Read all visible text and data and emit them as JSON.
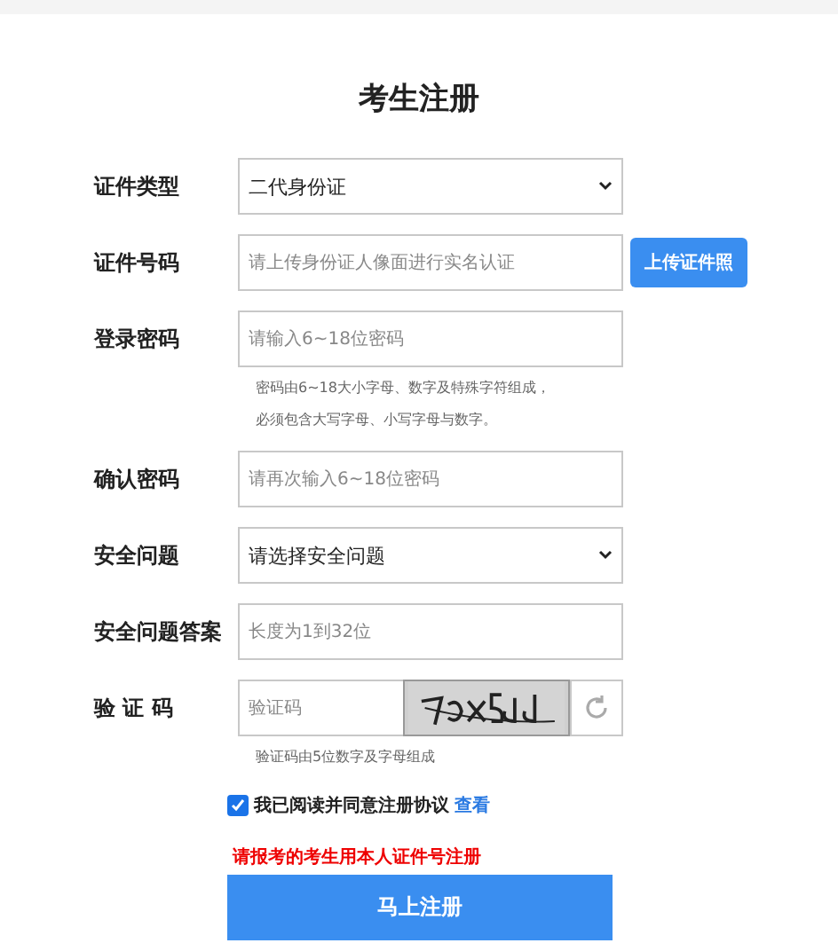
{
  "title": "考生注册",
  "fields": [
    {
      "kind": "select",
      "label": "证件类型",
      "value": "二代身份证"
    },
    {
      "kind": "input",
      "label": "证件号码",
      "placeholder": "请上传身份证人像面进行实名认证",
      "button": "上传证件照"
    },
    {
      "kind": "input",
      "label": "登录密码",
      "placeholder": "请输入6~18位密码",
      "hints": [
        "密码由6~18大小字母、数字及特殊字符组成，",
        "必须包含大写字母、小写字母与数字。"
      ]
    },
    {
      "kind": "input",
      "label": "确认密码",
      "placeholder": "请再次输入6~18位密码"
    },
    {
      "kind": "select",
      "label": "安全问题",
      "value": "请选择安全问题"
    },
    {
      "kind": "input",
      "label": "安全问题答案",
      "placeholder": "长度为1到32位"
    },
    {
      "kind": "captcha",
      "label": "验 证 码",
      "placeholder": "验证码",
      "captcha": {
        "kind": "picture"
      },
      "hints": [
        "验证码由5位数字及字母组成"
      ]
    }
  ],
  "agreement": {
    "checked": true,
    "text": "我已阅读并同意注册协议",
    "link": "查看"
  },
  "warning": "请报考的考生用本人证件号注册",
  "submit": "马上注册"
}
